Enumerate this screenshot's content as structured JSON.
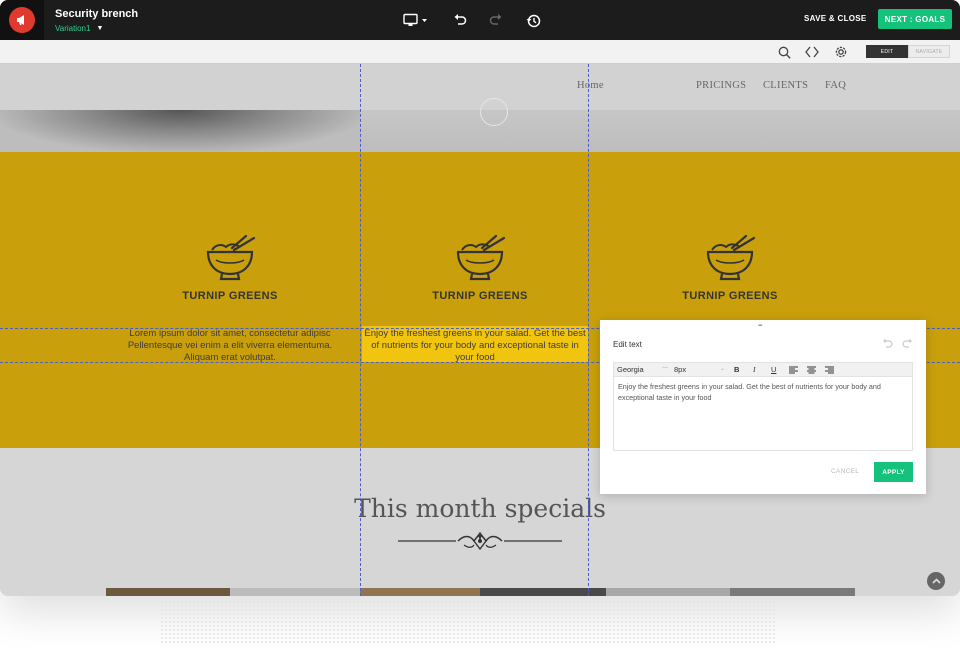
{
  "app": {
    "project_title": "Security brench",
    "variation": "Variation1"
  },
  "toolbar": {
    "save_close_label": "SAVE & CLOSE",
    "next_goals_label": "NEXT : GOALS",
    "icons": [
      "monitor-icon",
      "undo-icon",
      "redo-icon",
      "history-icon"
    ]
  },
  "subbar": {
    "icons": [
      "search-icon",
      "code-icon",
      "gear-icon"
    ],
    "mode_edit": "EDIT",
    "mode_navigate": "NAVIGATE"
  },
  "site": {
    "nav": {
      "home": "Home",
      "pricings": "PRICINGS",
      "clients": "CLIENTS",
      "faq": "FAQ"
    },
    "features": [
      {
        "title": "TURNIP GREENS",
        "text": "Lorem ipsum dolor sit amet, consectetur adipisc Pellentesque vei enim a elit viverra elementuma. Aliquam erat volutpat."
      },
      {
        "title": "TURNIP GREENS",
        "text": "Enjoy the freshest greens in your salad. Get the best of nutrients for your body and exceptional taste in your food"
      },
      {
        "title": "TURNIP GREENS",
        "text": ""
      }
    ],
    "specials_title": "This month specials"
  },
  "edit_panel": {
    "title": "Edit text",
    "font_family": "Georgia",
    "font_size": "8px",
    "format_buttons": [
      "B",
      "I",
      "U"
    ],
    "content": "Enjoy the freshest greens in your salad. Get the best of nutrients for your body and exceptional taste in your food",
    "cancel_label": "CANCEL",
    "apply_label": "APPLY"
  },
  "colors": {
    "accent_green": "#14c27b",
    "section_yellow": "#c9a00c",
    "selection_yellow": "#f1c40f",
    "guide_blue": "#4a5ec9",
    "logo_red": "#e03a2e"
  }
}
